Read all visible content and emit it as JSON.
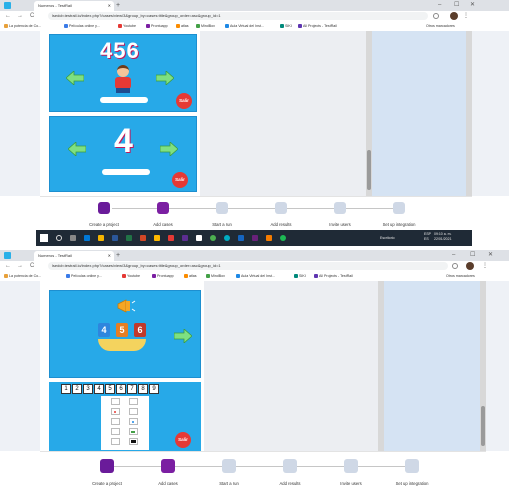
{
  "browser": {
    "tab_title": "Numeros - TestRail",
    "new_tab": "+",
    "window_controls": {
      "minimize": "–",
      "maximize": "☐",
      "close": "✕"
    },
    "back": "←",
    "forward": "→",
    "reload": "C",
    "url": "lsedcb.testrail.io/index.php?/cases/view/3&group_by=cases:title&group_order=asc&group_id=1",
    "bookmarks": [
      {
        "label": "La potencia de Co...",
        "color": "#e8a13a"
      },
      {
        "label": "Películas online y...",
        "color": "#3a7be8"
      },
      {
        "label": "Youtube",
        "color": "#e53935"
      },
      {
        "label": "Prontuapp",
        "color": "#7b1fa2"
      },
      {
        "label": "atlas",
        "color": "#fb8c00"
      },
      {
        "label": "MindBox",
        "color": "#43a047"
      },
      {
        "label": "Aula Virtual del Inst...",
        "color": "#1e88e5"
      },
      {
        "label": "SIKI",
        "color": "#00897b"
      },
      {
        "label": "All Projects - TestRail",
        "color": "#5e35b1"
      }
    ],
    "other_bookmarks": "Otros marcadores"
  },
  "game1": {
    "title_digits": [
      "4",
      "5",
      "6"
    ],
    "big_digit": "4",
    "exit_label": "Salir"
  },
  "game2": {
    "cards": [
      {
        "digit": "4",
        "color": "#2e86de"
      },
      {
        "digit": "5",
        "color": "#e67e22"
      },
      {
        "digit": "6",
        "color": "#c0392b"
      }
    ],
    "number_row": [
      "1",
      "2",
      "3",
      "4",
      "5",
      "6",
      "7",
      "8",
      "9"
    ],
    "exit_label": "Salir"
  },
  "steps": [
    {
      "label": "Create a project",
      "icon": "project-icon",
      "color": "#6a1b9a",
      "done": true
    },
    {
      "label": "Add cases",
      "icon": "cases-icon",
      "color": "#7b1fa2",
      "done": true
    },
    {
      "label": "Start a run",
      "icon": "run-icon",
      "color": "#cfd8e6",
      "done": false
    },
    {
      "label": "Add results",
      "icon": "results-icon",
      "color": "#cfd8e6",
      "done": false
    },
    {
      "label": "Invite users",
      "icon": "users-icon",
      "color": "#cfd8e6",
      "done": false
    },
    {
      "label": "Set up integration",
      "icon": "integration-icon",
      "color": "#cfd8e6",
      "done": false
    }
  ],
  "taskbar": {
    "user": "Escritorio",
    "language": "ESP",
    "region": "ES",
    "time": "09:10 a. m.",
    "date": "22/01/2021"
  }
}
